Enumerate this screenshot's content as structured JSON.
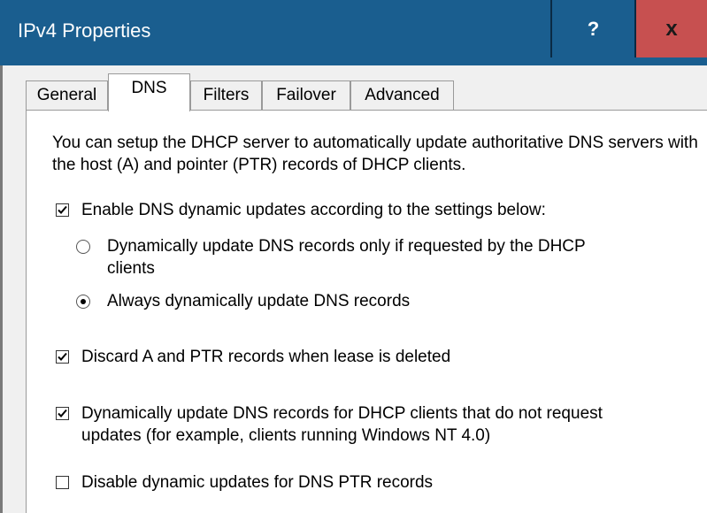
{
  "window": {
    "title": "IPv4 Properties",
    "help_label": "?",
    "close_label": "x",
    "titlebar_color": "#1a5e8f",
    "close_color": "#c75050"
  },
  "tabs": [
    {
      "label": "General",
      "active": false
    },
    {
      "label": "DNS",
      "active": true
    },
    {
      "label": "Filters",
      "active": false
    },
    {
      "label": "Failover",
      "active": false
    },
    {
      "label": "Advanced",
      "active": false
    }
  ],
  "dns": {
    "intro": "You can setup the DHCP server to automatically update authoritative DNS servers with the host (A) and pointer (PTR) records of DHCP clients.",
    "enable_updates": {
      "label": "Enable DNS dynamic updates according to the settings below:",
      "checked": true
    },
    "radio_on_request": {
      "label_line1": "Dynamically update DNS records only if requested by the DHCP",
      "label_line2": "clients",
      "selected": false
    },
    "radio_always": {
      "label": "Always dynamically update DNS records",
      "selected": true
    },
    "discard_records": {
      "label": "Discard A and PTR records when lease is deleted",
      "checked": true
    },
    "update_non_requesting": {
      "label_line1": "Dynamically update DNS records for DHCP clients that do not request",
      "label_line2": "updates (for example, clients running Windows NT 4.0)",
      "checked": true
    },
    "disable_ptr": {
      "label": "Disable dynamic updates for DNS PTR records",
      "checked": false
    }
  }
}
